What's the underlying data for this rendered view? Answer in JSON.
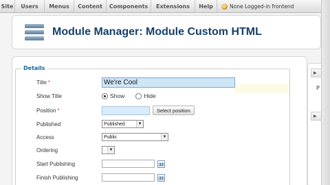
{
  "menubar": {
    "items": [
      "Site",
      "Users",
      "Menus",
      "Content",
      "Components",
      "Extensions",
      "Help"
    ],
    "status_text": "None Logged-in frontend"
  },
  "header": {
    "title": "Module Manager: Module Custom HTML",
    "icon": "module-stack-icon"
  },
  "details": {
    "legend": "Details",
    "title_label": "Title",
    "title_value": "We're Cool",
    "show_title_label": "Show Title",
    "show_option": "Show",
    "hide_option": "Hide",
    "position_label": "Position",
    "position_value": "",
    "select_position_button": "Select position",
    "published_label": "Published",
    "published_value": "Published",
    "access_label": "Access",
    "access_value": "Public",
    "ordering_label": "Ordering",
    "ordering_value": "",
    "start_publishing_label": "Start Publishing",
    "finish_publishing_label": "Finish Publishing",
    "calendar_icon_text": "33",
    "required_mark": "*"
  },
  "side_panel": {
    "letter": "P"
  },
  "colors": {
    "title_blue": "#15406a",
    "legend_blue": "#146295",
    "required_red": "#ee3333",
    "active_input": "#cfe6f7"
  }
}
